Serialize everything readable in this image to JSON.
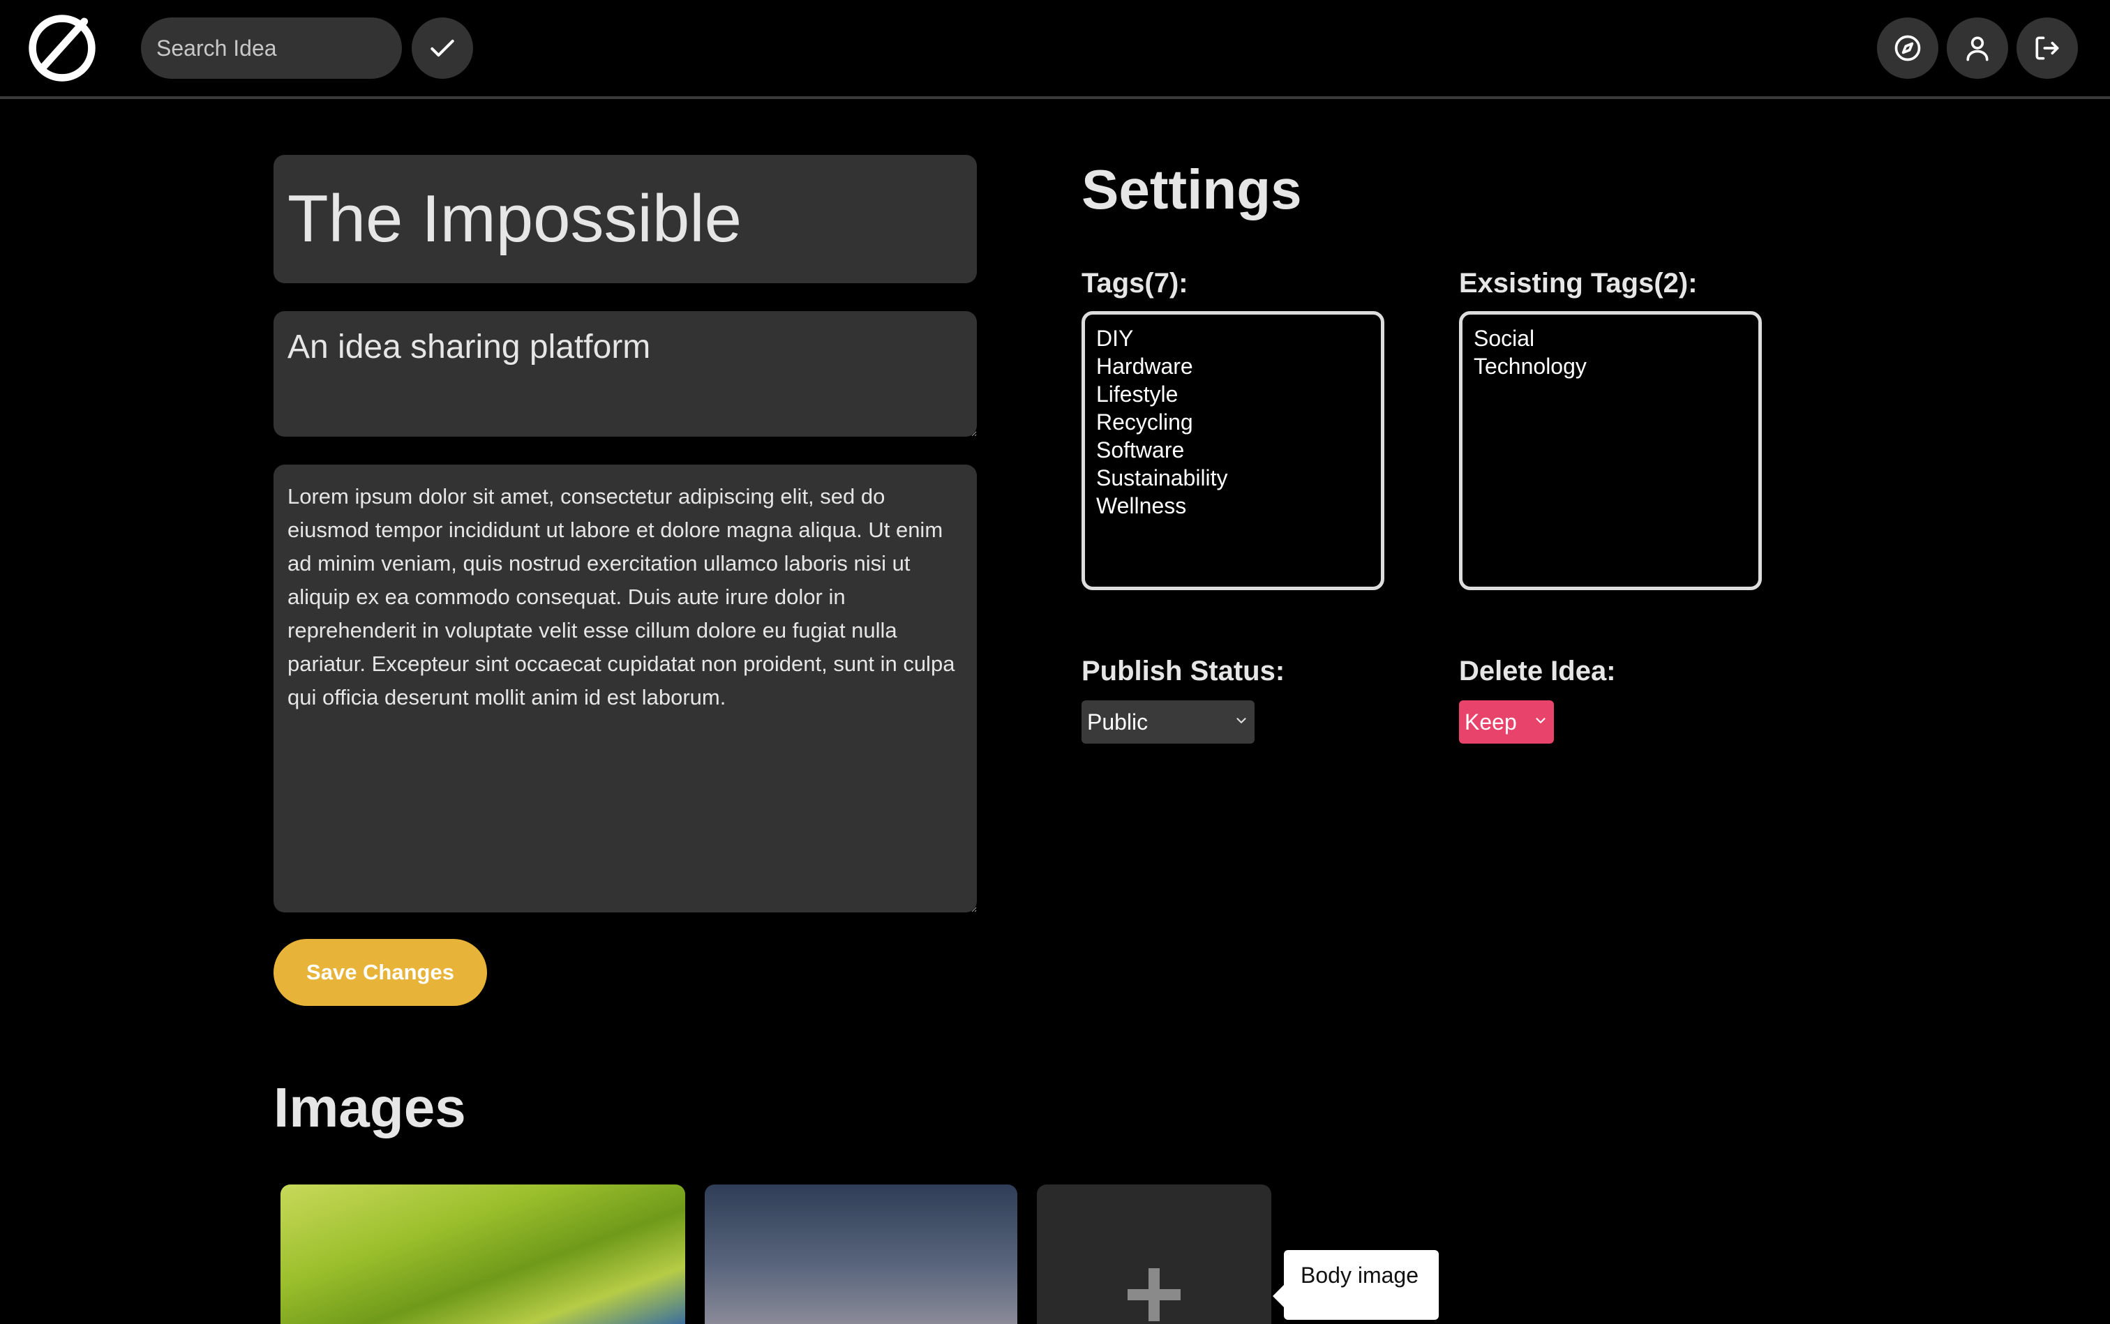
{
  "nav": {
    "search_placeholder": "Search Idea",
    "icons": {
      "logo": "brand-logo",
      "confirm": "check-icon",
      "explore": "compass-icon",
      "profile": "user-icon",
      "logout": "logout-icon"
    }
  },
  "idea": {
    "title": "The Impossible",
    "subtitle": "An idea sharing platform",
    "body": "Lorem ipsum dolor sit amet, consectetur adipiscing elit, sed do eiusmod tempor incididunt ut labore et dolore magna aliqua. Ut enim ad minim veniam, quis nostrud exercitation ullamco laboris nisi ut aliquip ex ea commodo consequat. Duis aute irure dolor in reprehenderit in voluptate velit esse cillum dolore eu fugiat nulla pariatur. Excepteur sint occaecat cupidatat non proident, sunt in culpa qui officia deserunt mollit anim id est laborum.",
    "save_label": "Save Changes"
  },
  "settings": {
    "heading": "Settings",
    "tags_label": "Tags(7):",
    "tags": [
      "DIY",
      "Hardware",
      "Lifestyle",
      "Recycling",
      "Software",
      "Sustainability",
      "Wellness"
    ],
    "existing_label": "Exsisting Tags(2):",
    "existing_tags": [
      "Social",
      "Technology"
    ],
    "publish_label": "Publish Status:",
    "publish_value": "Public",
    "delete_label": "Delete Idea:",
    "delete_value": "Keep"
  },
  "images": {
    "heading": "Images",
    "tooltip": "Body image"
  },
  "colors": {
    "background": "#000000",
    "field": "#333333",
    "accent": "#e8b339",
    "danger": "#e8436b"
  }
}
